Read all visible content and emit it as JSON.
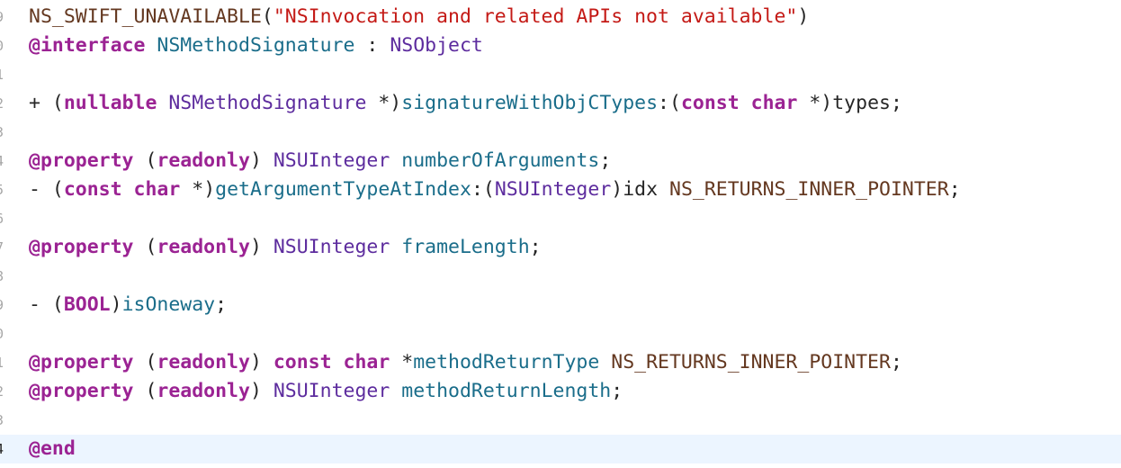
{
  "editor": {
    "current_line": 15,
    "lines": [
      {
        "number": "9",
        "tokens": [
          {
            "text": "NS_SWIFT_UNAVAILABLE",
            "kind": "macro"
          },
          {
            "text": "(",
            "kind": "plain"
          },
          {
            "text": "\"NSInvocation and related APIs not available\"",
            "kind": "string"
          },
          {
            "text": ")",
            "kind": "plain"
          }
        ]
      },
      {
        "number": "0",
        "tokens": [
          {
            "text": "@interface",
            "kind": "keyword"
          },
          {
            "text": " ",
            "kind": "plain"
          },
          {
            "text": "NSMethodSignature",
            "kind": "method"
          },
          {
            "text": " : ",
            "kind": "plain"
          },
          {
            "text": "NSObject",
            "kind": "type"
          }
        ]
      },
      {
        "number": "1",
        "tokens": []
      },
      {
        "number": "2",
        "tokens": [
          {
            "text": "+ (",
            "kind": "plain"
          },
          {
            "text": "nullable",
            "kind": "keyword"
          },
          {
            "text": " ",
            "kind": "plain"
          },
          {
            "text": "NSMethodSignature",
            "kind": "type"
          },
          {
            "text": " *)",
            "kind": "plain"
          },
          {
            "text": "signatureWithObjCTypes",
            "kind": "method"
          },
          {
            "text": ":(",
            "kind": "plain"
          },
          {
            "text": "const",
            "kind": "keyword"
          },
          {
            "text": " ",
            "kind": "plain"
          },
          {
            "text": "char",
            "kind": "keyword"
          },
          {
            "text": " *)types;",
            "kind": "plain"
          }
        ]
      },
      {
        "number": "3",
        "tokens": []
      },
      {
        "number": "4",
        "tokens": [
          {
            "text": "@property",
            "kind": "keyword"
          },
          {
            "text": " (",
            "kind": "plain"
          },
          {
            "text": "readonly",
            "kind": "keyword"
          },
          {
            "text": ") ",
            "kind": "plain"
          },
          {
            "text": "NSUInteger",
            "kind": "type"
          },
          {
            "text": " ",
            "kind": "plain"
          },
          {
            "text": "numberOfArguments",
            "kind": "method"
          },
          {
            "text": ";",
            "kind": "plain"
          }
        ]
      },
      {
        "number": "5",
        "tokens": [
          {
            "text": "- (",
            "kind": "plain"
          },
          {
            "text": "const",
            "kind": "keyword"
          },
          {
            "text": " ",
            "kind": "plain"
          },
          {
            "text": "char",
            "kind": "keyword"
          },
          {
            "text": " *)",
            "kind": "plain"
          },
          {
            "text": "getArgumentTypeAtIndex",
            "kind": "method"
          },
          {
            "text": ":(",
            "kind": "plain"
          },
          {
            "text": "NSUInteger",
            "kind": "type"
          },
          {
            "text": ")idx ",
            "kind": "plain"
          },
          {
            "text": "NS_RETURNS_INNER_POINTER",
            "kind": "macro"
          },
          {
            "text": ";",
            "kind": "plain"
          }
        ]
      },
      {
        "number": "6",
        "tokens": []
      },
      {
        "number": "7",
        "tokens": [
          {
            "text": "@property",
            "kind": "keyword"
          },
          {
            "text": " (",
            "kind": "plain"
          },
          {
            "text": "readonly",
            "kind": "keyword"
          },
          {
            "text": ") ",
            "kind": "plain"
          },
          {
            "text": "NSUInteger",
            "kind": "type"
          },
          {
            "text": " ",
            "kind": "plain"
          },
          {
            "text": "frameLength",
            "kind": "method"
          },
          {
            "text": ";",
            "kind": "plain"
          }
        ]
      },
      {
        "number": "8",
        "tokens": []
      },
      {
        "number": "9",
        "tokens": [
          {
            "text": "- (",
            "kind": "plain"
          },
          {
            "text": "BOOL",
            "kind": "keyword"
          },
          {
            "text": ")",
            "kind": "plain"
          },
          {
            "text": "isOneway",
            "kind": "method"
          },
          {
            "text": ";",
            "kind": "plain"
          }
        ]
      },
      {
        "number": "0",
        "tokens": []
      },
      {
        "number": "1",
        "tokens": [
          {
            "text": "@property",
            "kind": "keyword"
          },
          {
            "text": " (",
            "kind": "plain"
          },
          {
            "text": "readonly",
            "kind": "keyword"
          },
          {
            "text": ") ",
            "kind": "plain"
          },
          {
            "text": "const",
            "kind": "keyword"
          },
          {
            "text": " ",
            "kind": "plain"
          },
          {
            "text": "char",
            "kind": "keyword"
          },
          {
            "text": " *",
            "kind": "plain"
          },
          {
            "text": "methodReturnType",
            "kind": "method"
          },
          {
            "text": " ",
            "kind": "plain"
          },
          {
            "text": "NS_RETURNS_INNER_POINTER",
            "kind": "macro"
          },
          {
            "text": ";",
            "kind": "plain"
          }
        ]
      },
      {
        "number": "2",
        "tokens": [
          {
            "text": "@property",
            "kind": "keyword"
          },
          {
            "text": " (",
            "kind": "plain"
          },
          {
            "text": "readonly",
            "kind": "keyword"
          },
          {
            "text": ") ",
            "kind": "plain"
          },
          {
            "text": "NSUInteger",
            "kind": "type"
          },
          {
            "text": " ",
            "kind": "plain"
          },
          {
            "text": "methodReturnLength",
            "kind": "method"
          },
          {
            "text": ";",
            "kind": "plain"
          }
        ]
      },
      {
        "number": "3",
        "tokens": []
      },
      {
        "number": "4",
        "tokens": [
          {
            "text": "@end",
            "kind": "keyword"
          }
        ]
      }
    ]
  },
  "colors": {
    "background": "#ffffff",
    "current_line_highlight": "#ecf5ff",
    "keyword": "#9b2393",
    "macro": "#643820",
    "string": "#c41a16",
    "type": "#5d2c9e",
    "method": "#1a6d8a",
    "plain": "#262626",
    "gutter": "#a6a6a6"
  }
}
